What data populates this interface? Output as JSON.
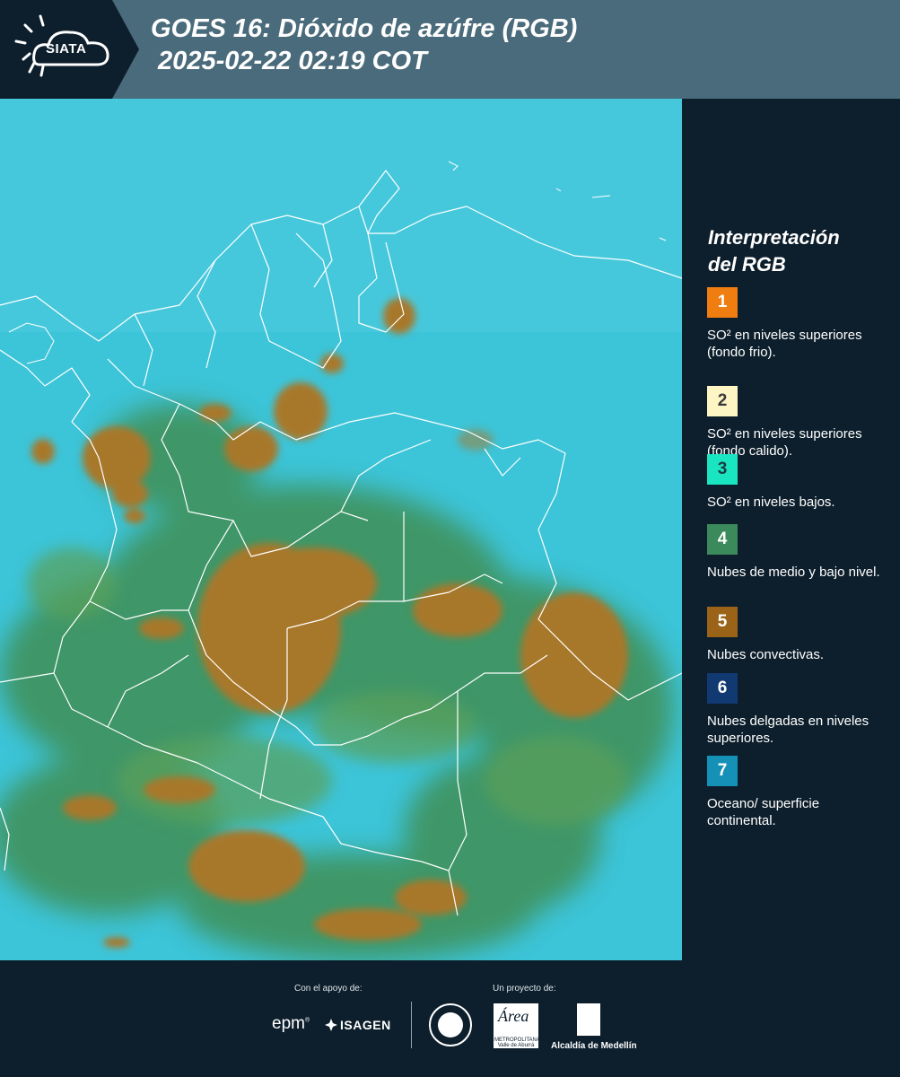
{
  "header": {
    "logo_text": "SIATA",
    "title_line1": "GOES 16: Dióxido de azúfre (RGB)",
    "title_line2": " 2025-02-22 02:19 COT",
    "background_color": "#4a6b7b"
  },
  "map": {
    "ocean_color": "#3bc3d6",
    "convective_cloud_color": "#a8782c",
    "low_cloud_color": "#3f8a55",
    "border_color": "#ffffff"
  },
  "legend": {
    "title_line1": "Interpretación",
    "title_line2": "del RGB",
    "items": [
      {
        "number": "1",
        "color": "#f07d10",
        "text_color": "#ffffff",
        "label": "SO² en niveles superiores (fondo frio)."
      },
      {
        "number": "2",
        "color": "#fdf5c4",
        "text_color": "#3a3a3a",
        "label": "SO² en niveles superiores (fondo calido)."
      },
      {
        "number": "3",
        "color": "#19e6c0",
        "text_color": "#1a3a40",
        "label": "SO² en niveles bajos."
      },
      {
        "number": "4",
        "color": "#3b8a5c",
        "text_color": "#ffffff",
        "label": "Nubes de medio y bajo nivel."
      },
      {
        "number": "5",
        "color": "#9a6318",
        "text_color": "#ffffff",
        "label": "Nubes convectivas."
      },
      {
        "number": "6",
        "color": "#123a72",
        "text_color": "#ffffff",
        "label": "Nubes delgadas en niveles superiores."
      },
      {
        "number": "7",
        "color": "#1591b8",
        "text_color": "#ffffff",
        "label": "Oceano/ superficie continental."
      }
    ]
  },
  "footer": {
    "support_label": "Con el apoyo de:",
    "project_label": "Un proyecto de:",
    "epm": "epm",
    "epm_mark": "®",
    "isagen": "ISAGEN",
    "area_word": "Área",
    "area_sub": "METROPOLITANA Valle de Aburrá",
    "alcaldia": "Alcaldía de Medellín"
  }
}
